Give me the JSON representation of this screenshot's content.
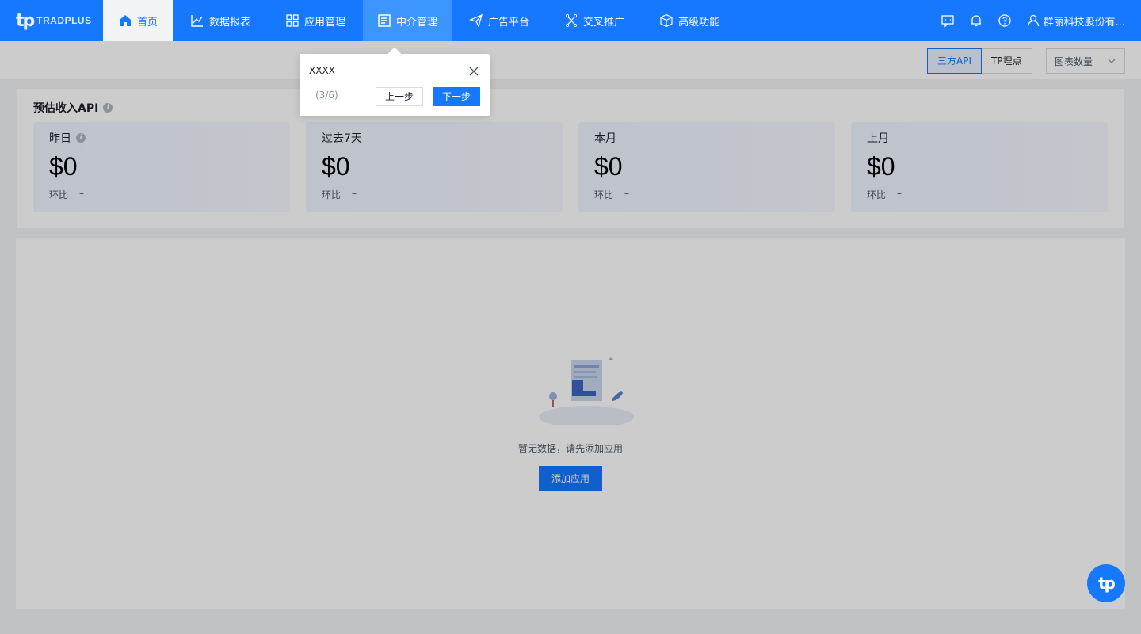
{
  "brand": {
    "mark": "tp",
    "word": "TRADPLUS"
  },
  "nav": {
    "items": [
      {
        "label": "首页",
        "icon": "home-icon"
      },
      {
        "label": "数据报表",
        "icon": "chart-line-icon"
      },
      {
        "label": "应用管理",
        "icon": "grid-icon"
      },
      {
        "label": "中介管理",
        "icon": "document-list-icon"
      },
      {
        "label": "广告平台",
        "icon": "send-icon"
      },
      {
        "label": "交叉推广",
        "icon": "network-icon"
      },
      {
        "label": "高级功能",
        "icon": "cube-icon"
      }
    ],
    "user": "群丽科技股份有..."
  },
  "toolbar": {
    "segments": [
      "三方API",
      "TP埋点"
    ],
    "dropdown": "图表数量"
  },
  "revenue": {
    "title": "预估收入API",
    "cards": [
      {
        "label": "昨日",
        "value": "$0",
        "compare_label": "环比",
        "compare_value": "–"
      },
      {
        "label": "过去7天",
        "value": "$0",
        "compare_label": "环比",
        "compare_value": "–"
      },
      {
        "label": "本月",
        "value": "$0",
        "compare_label": "环比",
        "compare_value": "–"
      },
      {
        "label": "上月",
        "value": "$0",
        "compare_label": "环比",
        "compare_value": "–"
      }
    ]
  },
  "empty": {
    "text": "暂无数据，请先添加应用",
    "button": "添加应用"
  },
  "guide": {
    "title": "XXXX",
    "step": "(3/6)",
    "prev": "上一步",
    "next": "下一步"
  },
  "fab": {
    "label": "tp"
  },
  "colors": {
    "primary": "#1677ff",
    "primary_light": "#3d95ff"
  }
}
